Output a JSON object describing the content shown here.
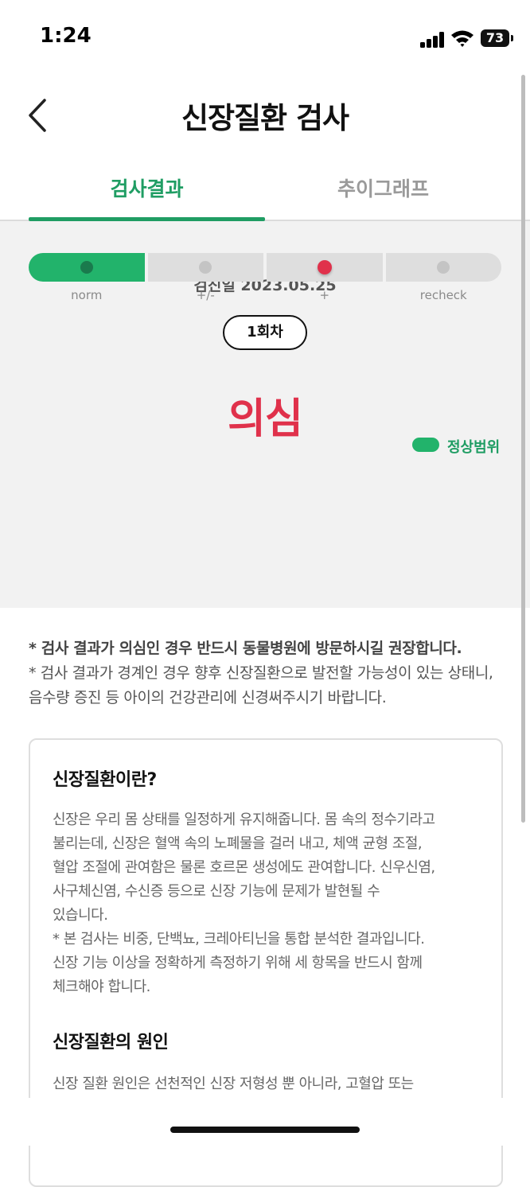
{
  "status_bar": {
    "time": "1:24",
    "battery_level": "73",
    "icons": [
      "cellular-signal-icon",
      "wifi-icon",
      "battery-icon"
    ]
  },
  "header": {
    "title": "신장질환 검사",
    "back_icon": "chevron-left-icon"
  },
  "tabs": [
    {
      "label": "검사결과",
      "active": true
    },
    {
      "label": "추이그래프",
      "active": false
    }
  ],
  "result": {
    "exam_date": "검진일 2023.05.25",
    "round_badge": "1회차",
    "status": "의심",
    "legend_label": "정상범위",
    "scale_labels": [
      "norm",
      "+/-",
      "+",
      "recheck"
    ],
    "normal_range_index": 0,
    "current_level_index": 2
  },
  "notice": {
    "line1": "* 검사 결과가 의심인 경우 반드시 동물병원에 방문하시길 권장합니다.",
    "line2": "* 검사 결과가 경계인 경우 향후 신장질환으로 발전할 가능성이 있는 상태니, 음수량 증진 등 아이의 건강관리에 신경써주시기 바랍니다."
  },
  "info": {
    "section1_title": "신장질환이란?",
    "section1_body_lines": [
      "신장은 우리 몸 상태를 일정하게 유지해줍니다. 몸 속의 정수기라고",
      "불리는데, 신장은 혈액 속의 노폐물을 걸러 내고, 체액 균형 조절,",
      "혈압 조절에 관여함은 물론 호르몬 생성에도 관여합니다. 신우신염,",
      "사구체신염, 수신증 등으로 신장 기능에 문제가 발현될 수",
      "있습니다.",
      "* 본 검사는 비중, 단백뇨, 크레아티닌을 통합 분석한 결과입니다.",
      "신장 기능 이상을 정확하게 측정하기 위해 세 항목을 반드시 함께",
      "체크해야 합니다."
    ],
    "section2_title": "신장질환의 원인",
    "section2_body_lines": [
      "신장 질환 원인은 선천적인 신장 저형성 뿐 아니라, 고혈압 또는"
    ]
  },
  "colors": {
    "accent_green": "#1f9d63",
    "normal_fill": "#22b36b",
    "alert_red": "#e0314b",
    "panel_bg": "#f2f2f2"
  }
}
